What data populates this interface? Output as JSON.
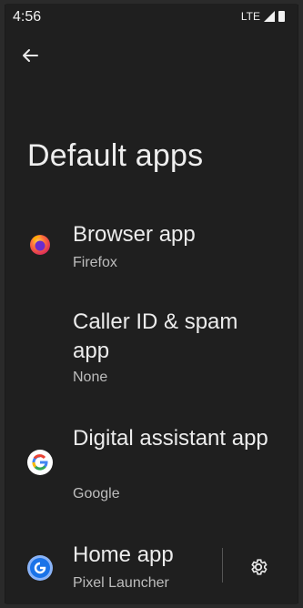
{
  "status": {
    "time": "4:56",
    "network": "LTE"
  },
  "page": {
    "title": "Default apps"
  },
  "items": [
    {
      "label": "Browser app",
      "sub": "Firefox",
      "icon": "firefox-icon"
    },
    {
      "label": "Caller ID & spam app",
      "sub": "None",
      "icon": ""
    },
    {
      "label": "Digital assistant app",
      "sub": "Google",
      "icon": "google-icon"
    },
    {
      "label": "Home app",
      "sub": "Pixel Launcher",
      "icon": "pixel-launcher-icon"
    }
  ],
  "colors": {
    "background": "#1f1f1f",
    "text": "#ececec",
    "subtext": "#bdbdbd"
  }
}
